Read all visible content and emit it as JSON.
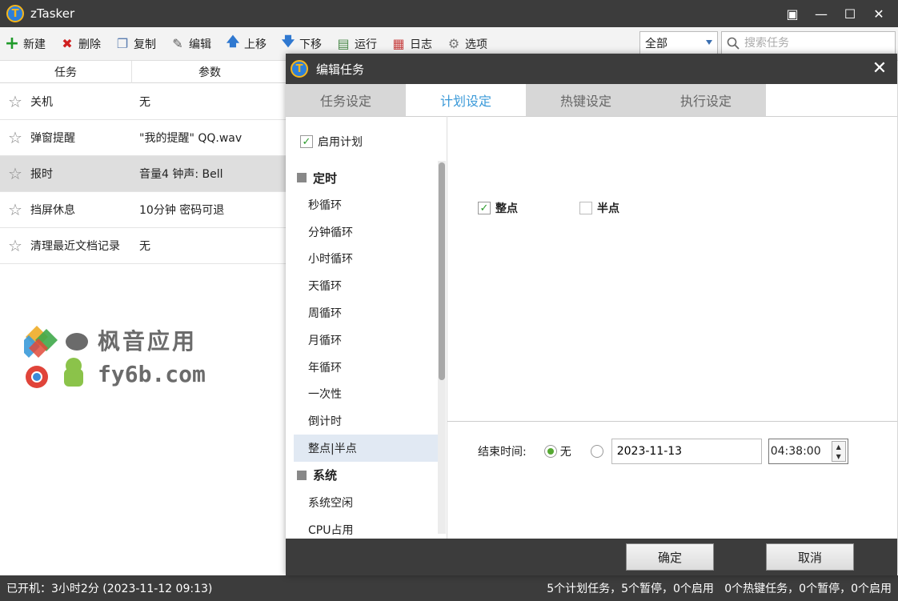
{
  "window": {
    "logo_letter": "T",
    "title": "zTasker",
    "buttons": [
      "▣",
      "—",
      "☐",
      "✕"
    ]
  },
  "toolbar": {
    "items": [
      {
        "label": "新建",
        "icon": "plus-icon",
        "glyph": "+",
        "color": "#1f9a2a"
      },
      {
        "label": "删除",
        "icon": "delete-icon",
        "glyph": "✖",
        "color": "#d02020"
      },
      {
        "label": "复制",
        "icon": "copy-icon",
        "glyph": "❐",
        "color": "#5a7db0"
      },
      {
        "label": "编辑",
        "icon": "edit-icon",
        "glyph": "✎",
        "color": "#5a5a5a"
      },
      {
        "label": "上移",
        "icon": "arrow-up-icon",
        "glyph": "🡅",
        "color": "#2f78d0"
      },
      {
        "label": "下移",
        "icon": "arrow-down-icon",
        "glyph": "🡇",
        "color": "#2f78d0"
      },
      {
        "label": "运行",
        "icon": "run-icon",
        "glyph": "▤",
        "color": "#4a8a4a"
      },
      {
        "label": "日志",
        "icon": "log-icon",
        "glyph": "▦",
        "color": "#c84040"
      },
      {
        "label": "选项",
        "icon": "gear-icon",
        "glyph": "⚙",
        "color": "#777777"
      }
    ],
    "filter_value": "全部",
    "search_placeholder": "搜索任务"
  },
  "task_list": {
    "headers": {
      "task": "任务",
      "param": "参数"
    },
    "rows": [
      {
        "name": "关机",
        "param": "无"
      },
      {
        "name": "弹窗提醒",
        "param": "\"我的提醒\" QQ.wav"
      },
      {
        "name": "报时",
        "param": "音量4 钟声: Bell"
      },
      {
        "name": "挡屏休息",
        "param": "10分钟 密码可退"
      },
      {
        "name": "清理最近文档记录",
        "param": "无"
      }
    ],
    "selected_index": 2
  },
  "watermark": {
    "line1": "枫音应用",
    "line2": "fy6b.com"
  },
  "status": {
    "left": "已开机：3小时2分 (2023-11-12 09:13)",
    "right": "5个计划任务，5个暂停，0个启用   0个热键任务，0个暂停，0个启用"
  },
  "dialog": {
    "title": "编辑任务",
    "close_glyph": "✕",
    "tabs": [
      "任务设定",
      "计划设定",
      "热键设定",
      "执行设定"
    ],
    "active_tab": 1,
    "enable_plan_label": "启用计划",
    "enable_plan_checked": true,
    "tree": {
      "groups": [
        {
          "label": "定时",
          "items": [
            "秒循环",
            "分钟循环",
            "小时循环",
            "天循环",
            "周循环",
            "月循环",
            "年循环",
            "一次性",
            "倒计时",
            "整点|半点"
          ]
        },
        {
          "label": "系统",
          "items": [
            "系统空闲",
            "CPU占用"
          ]
        }
      ],
      "selected_item": "整点|半点"
    },
    "options": {
      "on_hour_label": "整点",
      "on_hour_checked": true,
      "half_hour_label": "半点",
      "half_hour_checked": false
    },
    "end_time": {
      "label": "结束时间:",
      "none_label": "无",
      "none_selected": true,
      "date_value": "2023-11-13",
      "time_value": "04:38:00"
    },
    "ok_label": "确定",
    "cancel_label": "取消"
  }
}
